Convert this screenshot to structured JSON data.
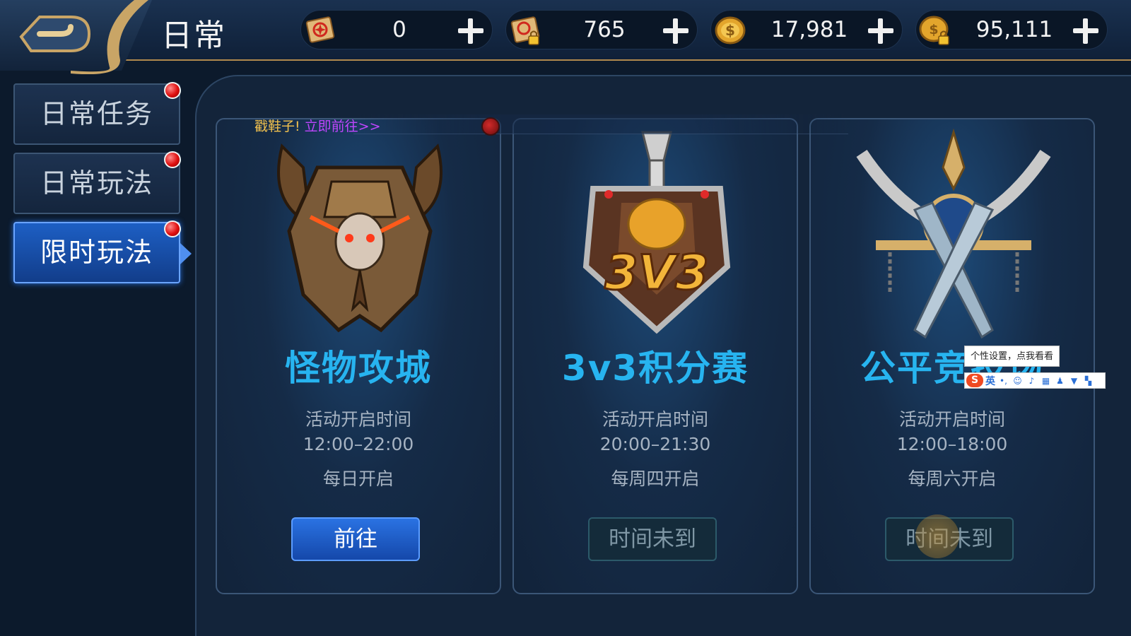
{
  "header": {
    "title": "日常",
    "resources": [
      {
        "icon": "scroll-icon",
        "value": "0"
      },
      {
        "icon": "locked-scroll-icon",
        "value": "765"
      },
      {
        "icon": "gold-coin-icon",
        "value": "17,981"
      },
      {
        "icon": "locked-coin-icon",
        "value": "95,111"
      }
    ]
  },
  "sidebar": {
    "items": [
      {
        "label": "日常任务",
        "active": false,
        "badge": true
      },
      {
        "label": "日常玩法",
        "active": false,
        "badge": true
      },
      {
        "label": "限时玩法",
        "active": true,
        "badge": true
      }
    ]
  },
  "ticker": {
    "text_a": "戳鞋子!",
    "text_b": "立即前往>>"
  },
  "cards": [
    {
      "title": "怪物攻城",
      "label": "活动开启时间",
      "time": "12:00–22:00",
      "day": "每日开启",
      "button": "前往",
      "button_state": "go"
    },
    {
      "title": "3v3积分赛",
      "label": "活动开启时间",
      "time": "20:00–21:30",
      "day": "每周四开启",
      "button": "时间未到",
      "button_state": "locked"
    },
    {
      "title": "公平竞技场",
      "label": "活动开启时间",
      "time": "12:00–18:00",
      "day": "每周六开启",
      "button": "时间未到",
      "button_state": "locked"
    }
  ],
  "ime": {
    "tooltip": "个性设置，点我看看",
    "lang": "英"
  },
  "colors": {
    "accent_blue": "#27b4f0",
    "gold": "#b0894e",
    "badge_red": "#e01010"
  }
}
